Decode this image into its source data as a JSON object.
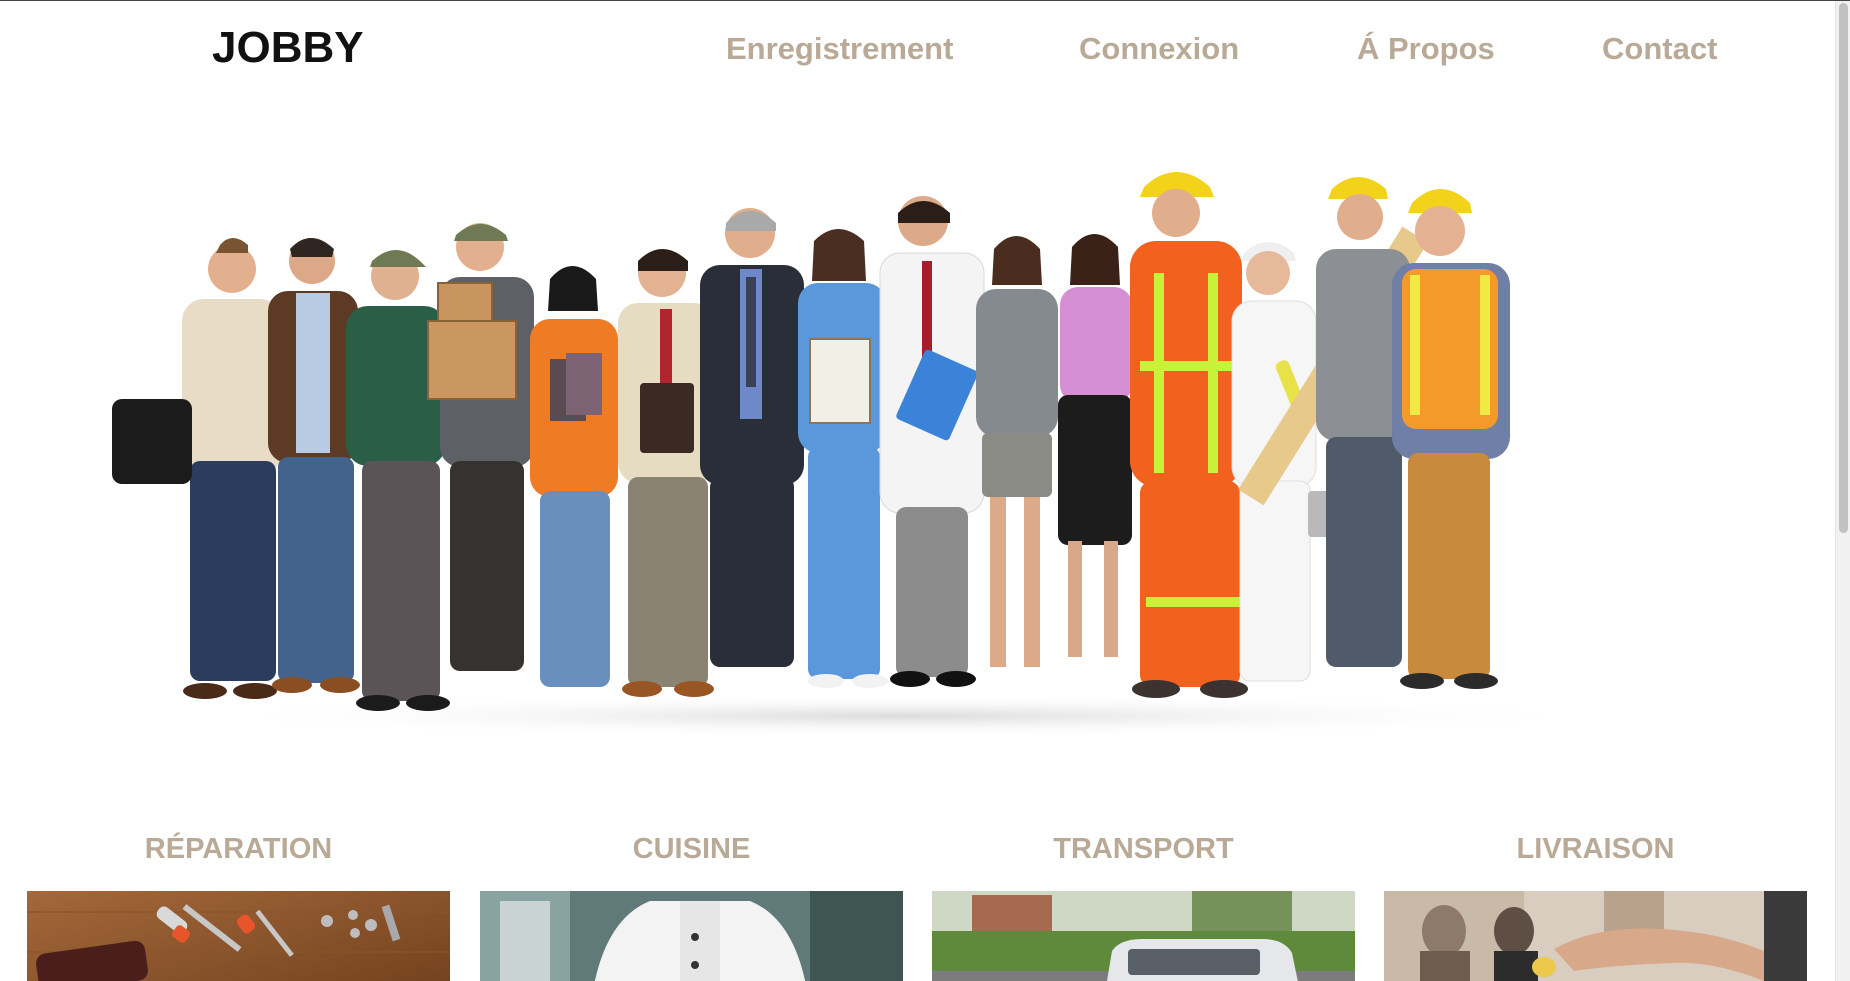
{
  "header": {
    "logo": "JOBBY",
    "nav": [
      {
        "label": "Enregistrement"
      },
      {
        "label": "Connexion"
      },
      {
        "label": "Á Propos"
      },
      {
        "label": "Contact"
      }
    ]
  },
  "hero": {
    "image_icon": "group-of-workers-image"
  },
  "categories": [
    {
      "title": "RÉPARATION",
      "image_icon": "tools-image"
    },
    {
      "title": "CUISINE",
      "image_icon": "chef-image"
    },
    {
      "title": "TRANSPORT",
      "image_icon": "van-image"
    },
    {
      "title": "LIVRAISON",
      "image_icon": "delivery-image"
    }
  ],
  "colors": {
    "nav_text": "#b9aa98",
    "logo_text": "#111111",
    "background": "#ffffff"
  }
}
